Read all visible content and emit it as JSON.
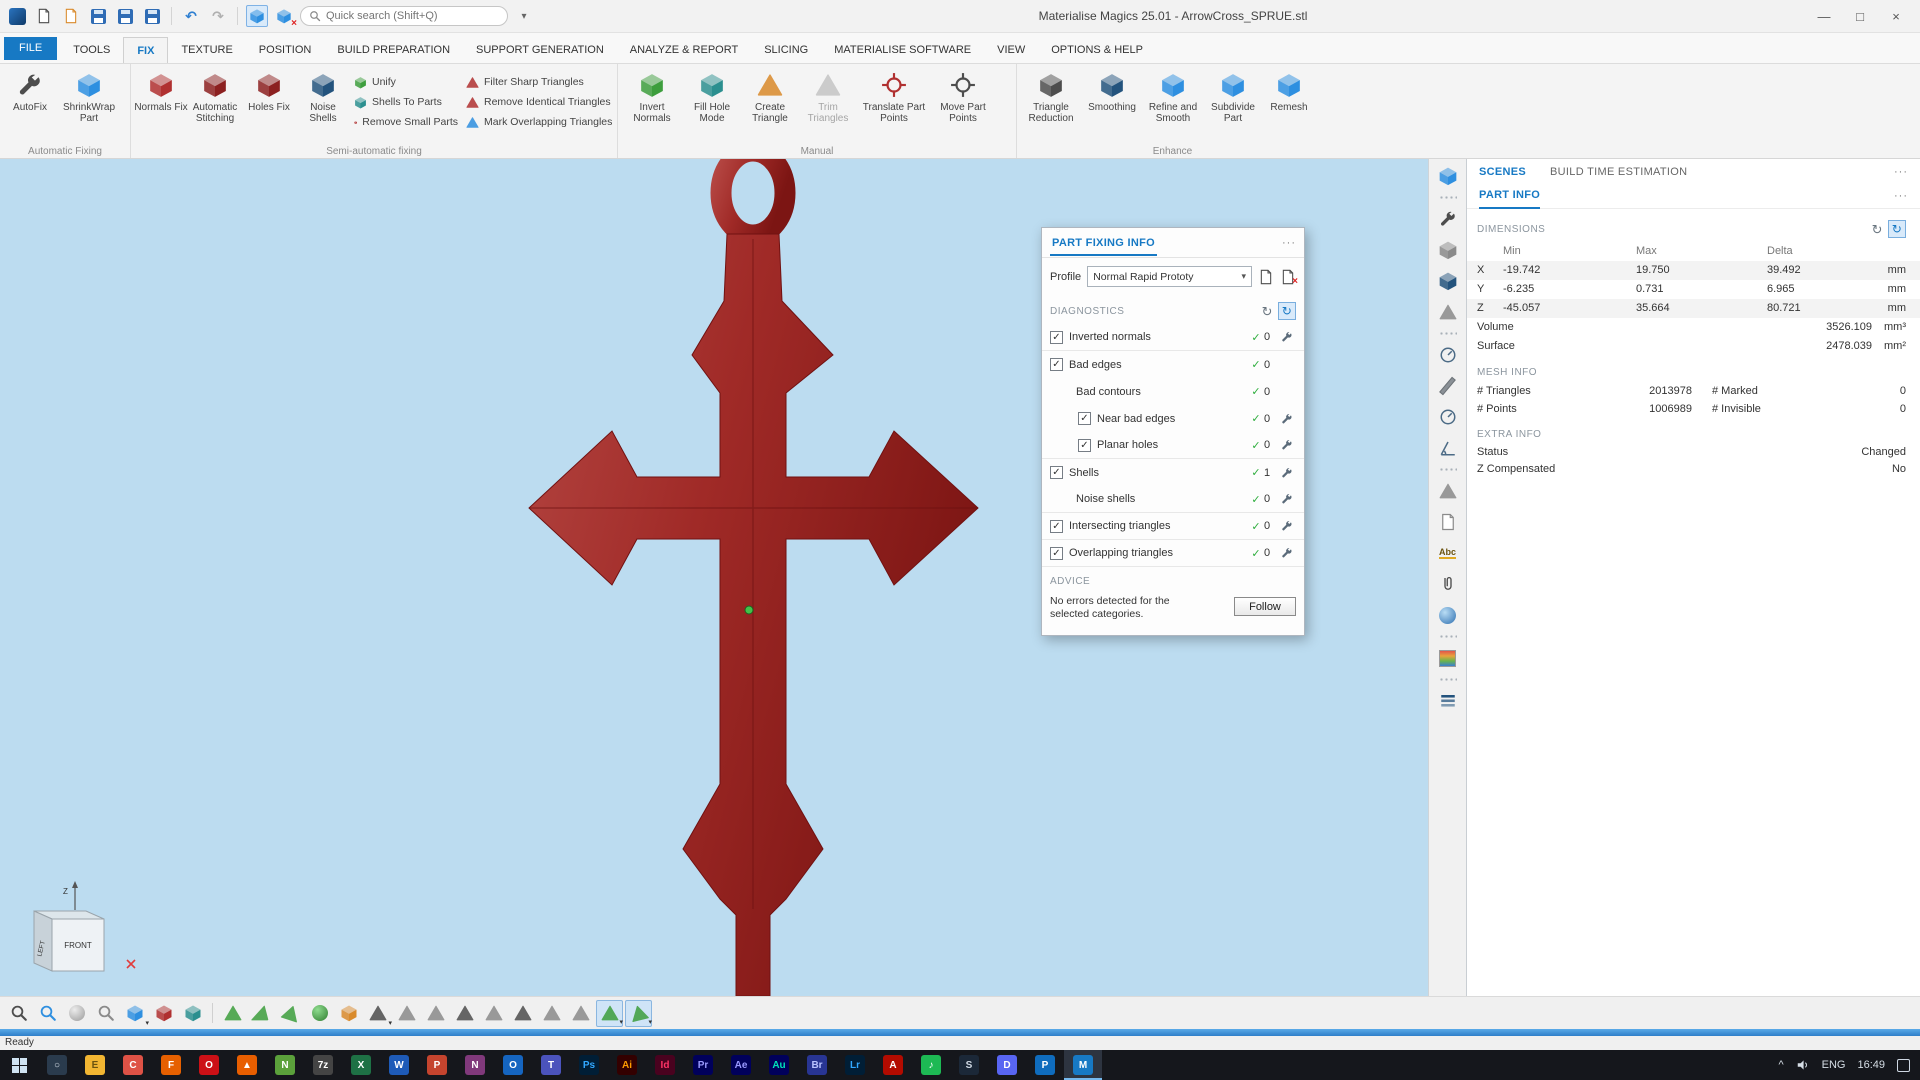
{
  "app": {
    "title": "Materialise Magics 25.01 - ArrowCross_SPRUE.stl",
    "search_placeholder": "Quick search (Shift+Q)"
  },
  "icons": {
    "check": "✓",
    "dropdown": "▾",
    "menu": "···",
    "refresh": "↻",
    "undo": "↶",
    "redo": "↷",
    "minimize": "—",
    "maximize": "□",
    "close": "×",
    "chevron_up": "^"
  },
  "tabs": {
    "items": [
      "FILE",
      "TOOLS",
      "FIX",
      "TEXTURE",
      "POSITION",
      "BUILD PREPARATION",
      "SUPPORT GENERATION",
      "ANALYZE & REPORT",
      "SLICING",
      "MATERIALISE SOFTWARE",
      "VIEW",
      "OPTIONS & HELP"
    ],
    "active": "FIX"
  },
  "ribbon": {
    "groups": [
      "Automatic Fixing",
      "Semi-automatic fixing",
      "Manual",
      "Enhance"
    ],
    "auto": [
      {
        "label": "AutoFix"
      },
      {
        "label": "ShrinkWrap Part"
      }
    ],
    "semi_large": [
      {
        "label": "Normals Fix"
      },
      {
        "label": "Automatic Stitching"
      },
      {
        "label": "Holes Fix"
      },
      {
        "label": "Noise Shells"
      }
    ],
    "semi_col1": [
      {
        "label": "Unify"
      },
      {
        "label": "Shells To Parts"
      },
      {
        "label": "Remove Small Parts"
      }
    ],
    "semi_col2": [
      {
        "label": "Filter Sharp Triangles"
      },
      {
        "label": "Remove Identical Triangles"
      },
      {
        "label": "Mark Overlapping Triangles"
      }
    ],
    "manual": [
      {
        "label": "Invert Normals"
      },
      {
        "label": "Fill Hole Mode"
      },
      {
        "label": "Create Triangle"
      },
      {
        "label": "Trim Triangles",
        "disabled": true
      },
      {
        "label": "Translate Part Points"
      },
      {
        "label": "Move Part Points"
      }
    ],
    "enhance": [
      {
        "label": "Triangle Reduction"
      },
      {
        "label": "Smoothing"
      },
      {
        "label": "Refine and Smooth"
      },
      {
        "label": "Subdivide Part"
      },
      {
        "label": "Remesh"
      }
    ]
  },
  "viewport": {
    "orientation": {
      "front": "FRONT",
      "left": "LEFT",
      "z": "Z"
    }
  },
  "fixing_panel": {
    "title": "PART FIXING INFO",
    "profile_label": "Profile",
    "profile_value": "Normal Rapid Prototy",
    "diagnostics_label": "DIAGNOSTICS",
    "rows": [
      {
        "label": "Inverted normals",
        "count": "0"
      },
      {
        "label": "Bad edges",
        "count": "0"
      },
      {
        "label": "Bad contours",
        "count": "0"
      },
      {
        "label": "Near bad edges",
        "count": "0"
      },
      {
        "label": "Planar holes",
        "count": "0"
      },
      {
        "label": "Shells",
        "count": "1"
      },
      {
        "label": "Noise shells",
        "count": "0"
      },
      {
        "label": "Intersecting triangles",
        "count": "0"
      },
      {
        "label": "Overlapping triangles",
        "count": "0"
      }
    ],
    "advice_label": "ADVICE",
    "advice_text": "No errors detected for the selected categories.",
    "follow_button": "Follow"
  },
  "right_panel": {
    "tab_scenes": "SCENES",
    "tab_build_time": "BUILD TIME ESTIMATION",
    "subtab_part_info": "PART INFO",
    "dimensions": {
      "label": "DIMENSIONS",
      "col_min": "Min",
      "col_max": "Max",
      "col_delta": "Delta",
      "rows": [
        {
          "axis": "X",
          "min": "-19.742",
          "max": "19.750",
          "delta": "39.492",
          "unit": "mm"
        },
        {
          "axis": "Y",
          "min": "-6.235",
          "max": "0.731",
          "delta": "6.965",
          "unit": "mm"
        },
        {
          "axis": "Z",
          "min": "-45.057",
          "max": "35.664",
          "delta": "80.721",
          "unit": "mm"
        }
      ],
      "volume_label": "Volume",
      "volume_value": "3526.109",
      "volume_unit": "mm³",
      "surface_label": "Surface",
      "surface_value": "2478.039",
      "surface_unit": "mm²"
    },
    "mesh_info": {
      "label": "MESH INFO",
      "triangles_label": "# Triangles",
      "triangles_value": "2013978",
      "marked_label": "# Marked",
      "marked_value": "0",
      "points_label": "# Points",
      "points_value": "1006989",
      "invisible_label": "# Invisible",
      "invisible_value": "0"
    },
    "extra_info": {
      "label": "EXTRA INFO",
      "status_label": "Status",
      "status_value": "Changed",
      "z_comp_label": "Z Compensated",
      "z_comp_value": "No"
    }
  },
  "right_strip": {
    "abc_label": "Abc",
    "icon_names": [
      "scenes-cube",
      "toolbox-wrench",
      "machine-cube",
      "part-cube",
      "support-pyramid",
      "measure-compass",
      "measure-ruler",
      "measure-diameter",
      "measure-angle",
      "report-polygon",
      "report-page",
      "annotate-abc",
      "attachment-clip",
      "texture-sphere",
      "colormap",
      "slices"
    ]
  },
  "toolbar_bottom": {
    "icon_names": [
      "zoom",
      "zoom-window",
      "orbit-ball",
      "zoom-part",
      "view-cube",
      "view-front",
      "view-iso",
      "mark-triangle",
      "mark-plane",
      "mark-surface",
      "mark-shell",
      "mark-window",
      "mark-brush",
      "unmark-triangle",
      "mark-rect-plus",
      "mark-rect-minus",
      "mark-connected",
      "mark-grow",
      "mark-shrink",
      "mark-free",
      "mark-plane-active",
      "mark-cusps-active"
    ]
  },
  "statusbar": {
    "ready": "Ready"
  },
  "taskbar": {
    "lang": "ENG",
    "time": "16:49",
    "apps": [
      {
        "name": "search",
        "bg": "#2a3b4d",
        "fg": "#d8e1ea",
        "glyph": "○"
      },
      {
        "name": "file-explorer",
        "bg": "#f2b632",
        "fg": "#6b5310",
        "glyph": "E"
      },
      {
        "name": "chrome",
        "bg": "#de5246",
        "fg": "#ffffff",
        "glyph": "C"
      },
      {
        "name": "firefox",
        "bg": "#e66000",
        "fg": "#ffffff",
        "glyph": "F"
      },
      {
        "name": "opera",
        "bg": "#cc1016",
        "fg": "#ffffff",
        "glyph": "O"
      },
      {
        "name": "vlc",
        "bg": "#e85e00",
        "fg": "#ffffff",
        "glyph": "▲"
      },
      {
        "name": "notepad-plus",
        "bg": "#5ba13b",
        "fg": "#ffffff",
        "glyph": "N"
      },
      {
        "name": "7zip",
        "bg": "#444444",
        "fg": "#ffffff",
        "glyph": "7z"
      },
      {
        "name": "excel",
        "bg": "#1e7145",
        "fg": "#ffffff",
        "glyph": "X"
      },
      {
        "name": "word",
        "bg": "#1e5bb8",
        "fg": "#ffffff",
        "glyph": "W"
      },
      {
        "name": "powerpoint",
        "bg": "#c5442e",
        "fg": "#ffffff",
        "glyph": "P"
      },
      {
        "name": "onenote",
        "bg": "#80397b",
        "fg": "#ffffff",
        "glyph": "N"
      },
      {
        "name": "outlook",
        "bg": "#1565c0",
        "fg": "#ffffff",
        "glyph": "O"
      },
      {
        "name": "teams",
        "bg": "#4b53bc",
        "fg": "#ffffff",
        "glyph": "T"
      },
      {
        "name": "photoshop",
        "bg": "#001e36",
        "fg": "#31a8ff",
        "glyph": "Ps"
      },
      {
        "name": "illustrator",
        "bg": "#330000",
        "fg": "#ff9a00",
        "glyph": "Ai"
      },
      {
        "name": "indesign",
        "bg": "#49021f",
        "fg": "#ff3366",
        "glyph": "Id"
      },
      {
        "name": "premiere",
        "bg": "#00005b",
        "fg": "#9999ff",
        "glyph": "Pr"
      },
      {
        "name": "after-effects",
        "bg": "#00005b",
        "fg": "#9999ff",
        "glyph": "Ae"
      },
      {
        "name": "audition",
        "bg": "#00005b",
        "fg": "#00e4bb",
        "glyph": "Au"
      },
      {
        "name": "bridge",
        "bg": "#283593",
        "fg": "#b9c3ff",
        "glyph": "Br"
      },
      {
        "name": "lightroom",
        "bg": "#001e36",
        "fg": "#31a8ff",
        "glyph": "Lr"
      },
      {
        "name": "acrob",
        "bg": "#b30b00",
        "fg": "#ffffff",
        "glyph": "A"
      },
      {
        "name": "spotify",
        "bg": "#1db954",
        "fg": "#ffffff",
        "glyph": "♪"
      },
      {
        "name": "steam",
        "bg": "#1b2838",
        "fg": "#cfd8e3",
        "glyph": "S"
      },
      {
        "name": "discord",
        "bg": "#5865f2",
        "fg": "#ffffff",
        "glyph": "D"
      },
      {
        "name": "photos",
        "bg": "#0f6cbd",
        "fg": "#ffffff",
        "glyph": "P"
      },
      {
        "name": "magics",
        "bg": "#1779c4",
        "fg": "#ffffff",
        "glyph": "M",
        "active": true
      }
    ]
  }
}
